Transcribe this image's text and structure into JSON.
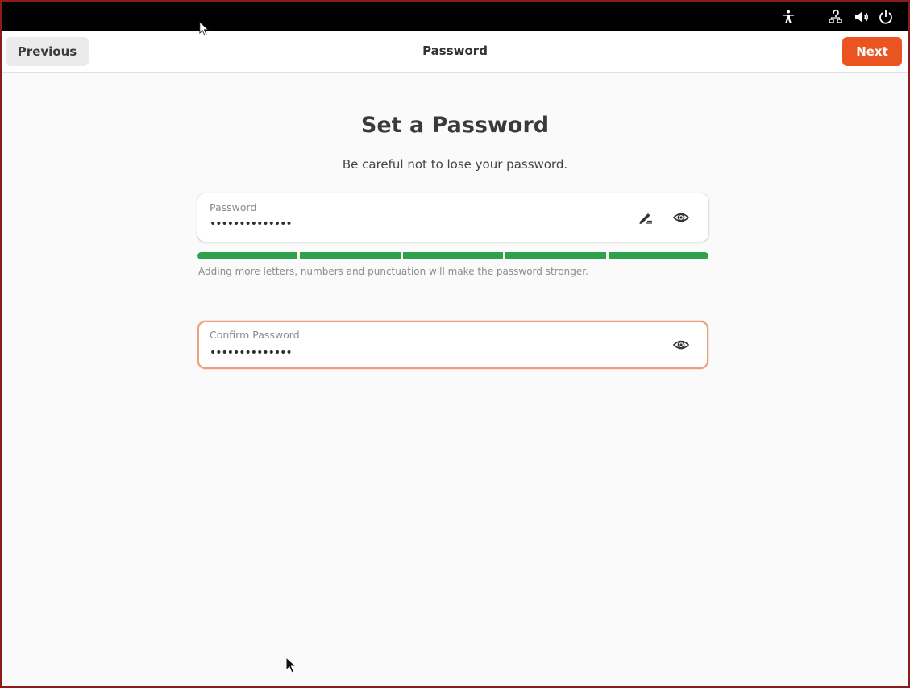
{
  "header": {
    "previous_label": "Previous",
    "title": "Password",
    "next_label": "Next"
  },
  "main": {
    "title": "Set a Password",
    "subtitle": "Be careful not to lose your password."
  },
  "password_field": {
    "label": "Password",
    "value": "••••••••••••••",
    "icons": [
      "edit-icon",
      "show-password-icon"
    ]
  },
  "strength_meter": {
    "segments_filled": 5,
    "segments_total": 5,
    "hint": "Adding more letters, numbers and punctuation will make the password stronger."
  },
  "confirm_field": {
    "label": "Confirm Password",
    "value": "••••••••••••••",
    "icons": [
      "show-password-icon"
    ]
  },
  "tray_icons": [
    "accessibility-icon",
    "network-icon",
    "volume-icon",
    "power-icon"
  ],
  "colors": {
    "accent": "#e95420",
    "strength": "#2fa14a",
    "focus_border": "#e9a07c"
  }
}
